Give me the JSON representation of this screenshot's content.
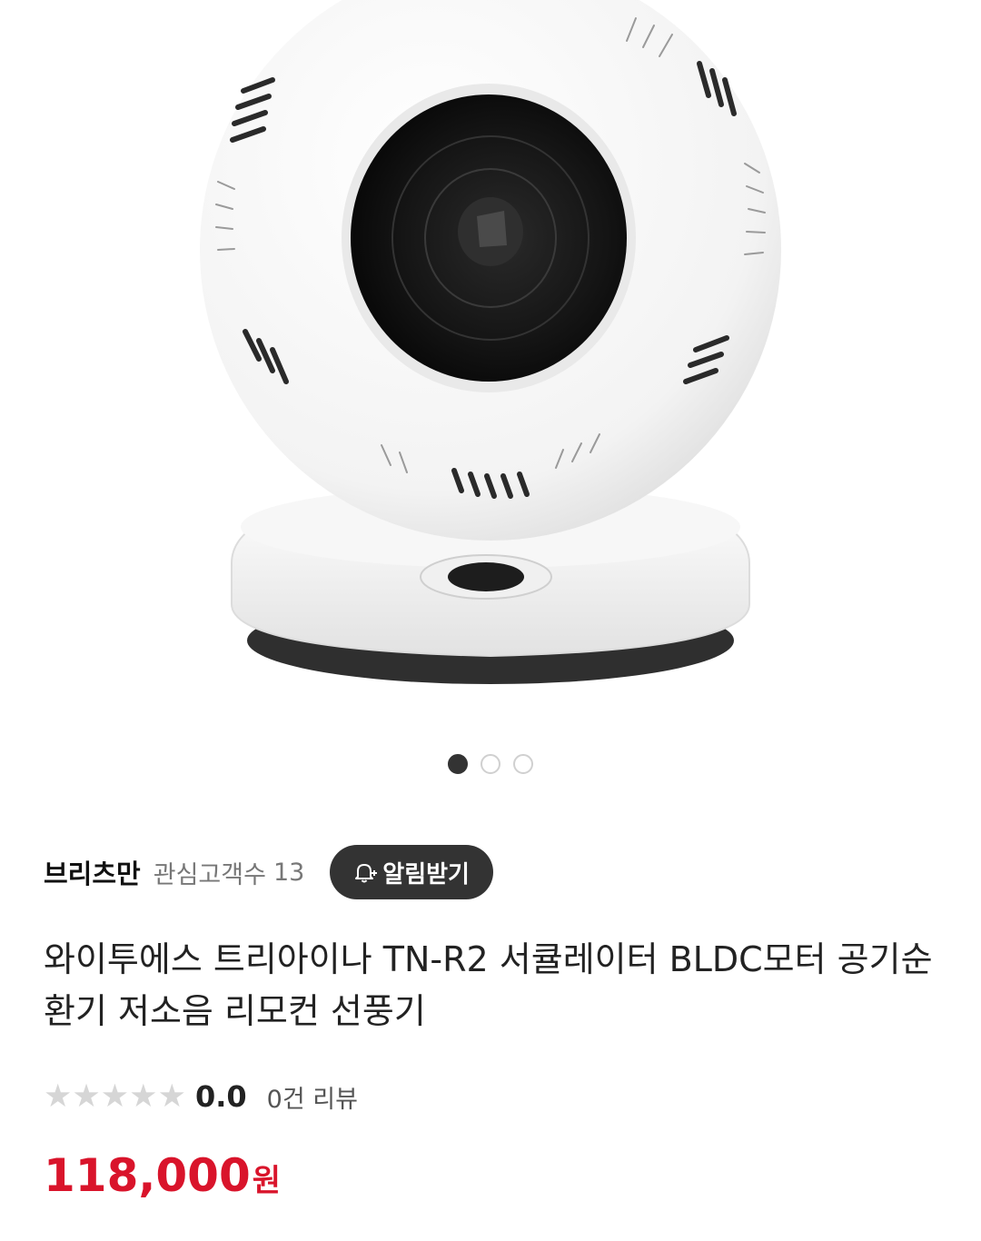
{
  "carousel": {
    "image_alt": "white spherical circulator fan",
    "pages": 3,
    "active_index": 0
  },
  "seller": {
    "name": "브리츠만",
    "follow_label": "관심고객수",
    "follow_count": "13",
    "alarm_label": "알림받기"
  },
  "product": {
    "title": "와이투에스 트리아이나 TN-R2 서큘레이터 BLDC모터 공기순환기 저소음 리모컨 선풍기"
  },
  "rating": {
    "score": "0.0",
    "stars_filled": 0,
    "stars_total": 5,
    "review_count": "0건 리뷰"
  },
  "price": {
    "amount": "118,000",
    "currency": "원"
  },
  "colors": {
    "price": "#d9142b",
    "button_bg": "#333333",
    "star_empty": "#d6d6d6"
  }
}
